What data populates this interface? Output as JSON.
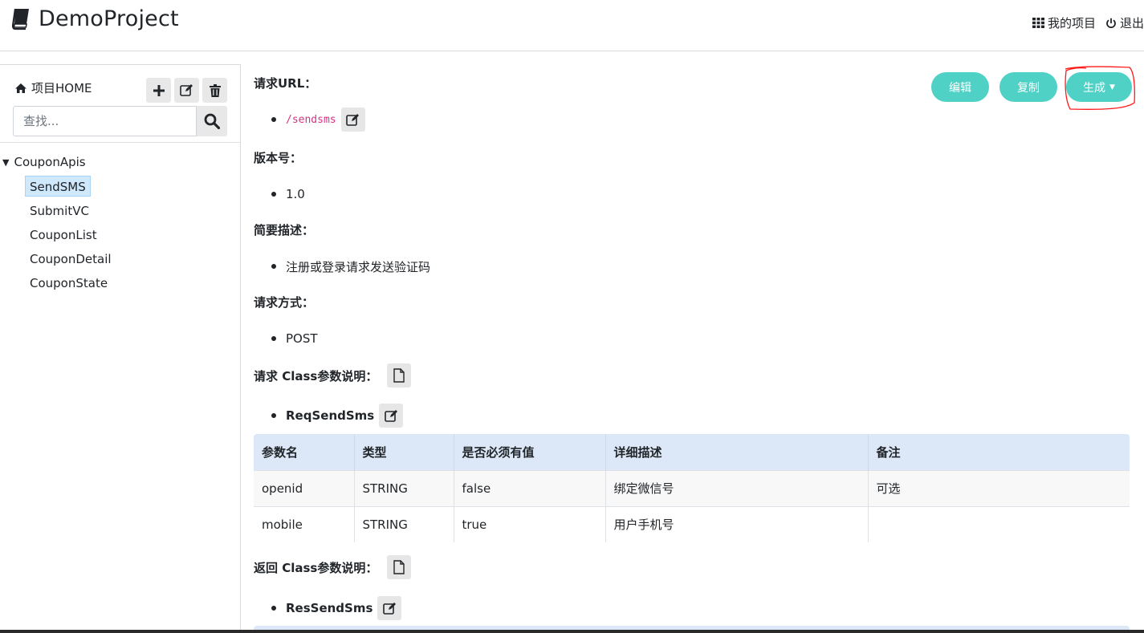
{
  "navbar": {
    "title": "DemoProject",
    "my_projects": "我的项目",
    "logout": "退出"
  },
  "sidebar": {
    "home_label": "项目HOME",
    "search_placeholder": "查找...",
    "group": "CouponApis",
    "items": [
      {
        "label": "SendSMS",
        "active": true
      },
      {
        "label": "SubmitVC",
        "active": false
      },
      {
        "label": "CouponList",
        "active": false
      },
      {
        "label": "CouponDetail",
        "active": false
      },
      {
        "label": "CouponState",
        "active": false
      }
    ]
  },
  "actions": {
    "edit": "编辑",
    "copy": "复制",
    "generate": "生成"
  },
  "content": {
    "url_label": "请求URL：",
    "url_value": "/sendsms",
    "version_label": "版本号：",
    "version_value": "1.0",
    "desc_label": "简要描述：",
    "desc_value": "注册或登录请求发送验证码",
    "method_label": "请求方式：",
    "method_value": "POST",
    "req_class_label": "请求 Class参数说明：",
    "req_class_name": "ReqSendSms",
    "res_class_label": "返回 Class参数说明：",
    "res_class_name": "ResSendSms"
  },
  "req_table": {
    "headers": [
      "参数名",
      "类型",
      "是否必须有值",
      "详细描述",
      "备注"
    ],
    "rows": [
      [
        "openid",
        "STRING",
        "false",
        "绑定微信号",
        "可选"
      ],
      [
        "mobile",
        "STRING",
        "true",
        "用户手机号",
        ""
      ]
    ]
  },
  "colors": {
    "accent": "#4fd1c5",
    "active_item": "#cfe8fc",
    "table_header": "#dce8f7",
    "annotation": "#ff0000"
  }
}
